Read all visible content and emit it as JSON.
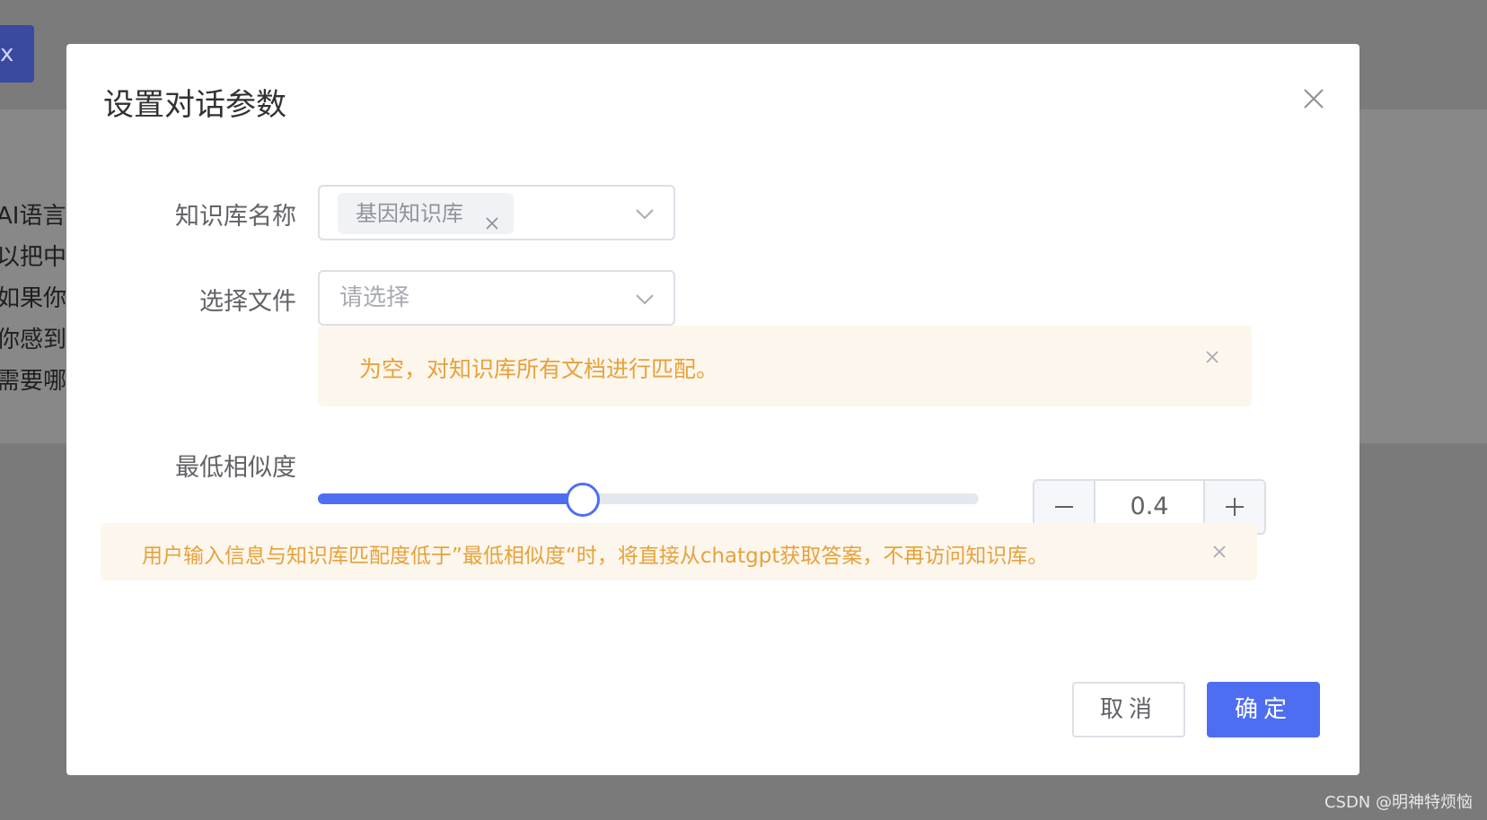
{
  "background": {
    "button_fragment": "x",
    "text_fragments": [
      "AI语言",
      "以把中",
      "如果你",
      "你感到",
      "需要哪"
    ]
  },
  "dialog": {
    "title": "设置对话参数",
    "close_icon": "close-icon"
  },
  "form": {
    "knowledge_base": {
      "label": "知识库名称",
      "selected_tag": "基因知识库"
    },
    "file_select": {
      "label": "选择文件",
      "placeholder": "请选择"
    },
    "file_alert": "为空，对知识库所有文档进行匹配。",
    "similarity": {
      "label": "最低相似度",
      "value": "0.4",
      "slider_fraction": 0.4
    },
    "similarity_alert": "用户输入信息与知识库匹配度低于”最低相似度“时，将直接从chatgpt获取答案，不再访问知识库。"
  },
  "footer": {
    "cancel_label": "取消",
    "confirm_label": "确定"
  },
  "colors": {
    "primary": "#4e6ef2",
    "warning_text": "#e6a23c",
    "warning_bg": "#fdf6ec"
  },
  "watermark": "CSDN @明神特烦恼"
}
